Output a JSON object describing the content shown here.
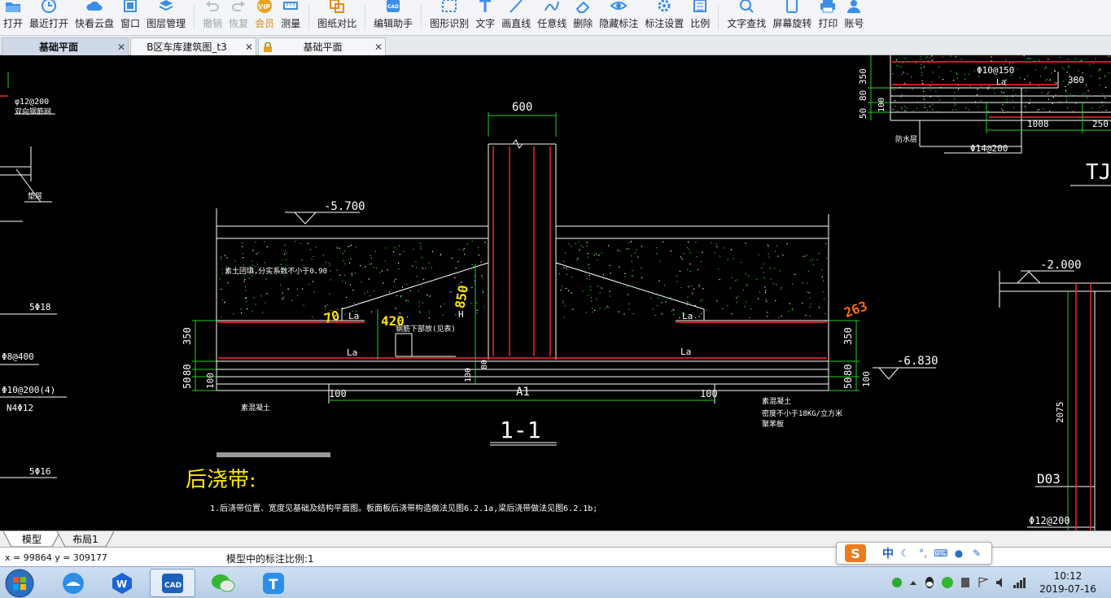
{
  "toolbar": {
    "items": [
      {
        "label": "打开",
        "icon": "folder-open-icon",
        "disabled": false
      },
      {
        "label": "最近打开",
        "icon": "clock-icon",
        "disabled": false
      },
      {
        "label": "快看云盘",
        "icon": "cloud-icon",
        "disabled": false
      },
      {
        "label": "窗口",
        "icon": "window-icon",
        "disabled": false
      },
      {
        "label": "图层管理",
        "icon": "layers-icon",
        "disabled": false
      },
      {
        "label": "撤销",
        "icon": "undo-icon",
        "disabled": true
      },
      {
        "label": "恢复",
        "icon": "redo-icon",
        "disabled": true
      },
      {
        "label": "会员",
        "icon": "vip-icon",
        "disabled": false,
        "badge": "VIP"
      },
      {
        "label": "测量",
        "icon": "ruler-icon",
        "disabled": false
      },
      {
        "label": "图纸对比",
        "icon": "compare-icon",
        "disabled": false
      },
      {
        "label": "编辑助手",
        "icon": "edit-assistant-icon",
        "disabled": false,
        "badge": "CAD"
      },
      {
        "label": "图形识别",
        "icon": "shape-recognize-icon",
        "disabled": false
      },
      {
        "label": "文字",
        "icon": "text-icon",
        "disabled": false
      },
      {
        "label": "画直线",
        "icon": "line-icon",
        "disabled": false
      },
      {
        "label": "任意线",
        "icon": "freehand-line-icon",
        "disabled": false
      },
      {
        "label": "删除",
        "icon": "eraser-icon",
        "disabled": false
      },
      {
        "label": "隐藏标注",
        "icon": "eye-icon",
        "disabled": false
      },
      {
        "label": "标注设置",
        "icon": "gear-icon",
        "disabled": false
      },
      {
        "label": "比例",
        "icon": "scale-icon",
        "disabled": false
      },
      {
        "label": "文字查找",
        "icon": "text-search-icon",
        "disabled": false
      },
      {
        "label": "屏幕旋转",
        "icon": "rotate-screen-icon",
        "disabled": false
      },
      {
        "label": "打印",
        "icon": "printer-icon",
        "disabled": false
      },
      {
        "label": "账号",
        "icon": "user-icon",
        "disabled": false
      }
    ]
  },
  "tabs": [
    {
      "label": "基础平面",
      "active": true,
      "locked": false
    },
    {
      "label": "B区车库建筑图_t3",
      "active": false,
      "locked": false
    },
    {
      "label": "基础平面",
      "active": false,
      "locked": true
    }
  ],
  "drawing": {
    "dim_600": "600",
    "elev_left": "-5.700",
    "elev_right": "-6.830",
    "elev_upper_right": "-2.000",
    "dim_350_left": "350",
    "dim_80_left": "80",
    "dim_50_left": "50",
    "dim_100_left": "100",
    "dim_350_right": "350",
    "dim_80_right": "80",
    "dim_50_right": "50",
    "dim_100_right": "100",
    "dim_100_a": "100",
    "dim_100_b": "100",
    "dim_100_c": "100",
    "dim_80_c": "80",
    "center_label": "A1",
    "la_1": "La",
    "la_2": "La",
    "la_3": "La",
    "la_4": "La",
    "la_5": "La",
    "la_6": "La",
    "h_mark": "H",
    "backfill_note": "素土回填,分实系数不小于0.90",
    "rebar_note_mid": "钢筋下部放(见表)",
    "section_title": "1-1",
    "houjiao_title": "后浇带:",
    "houjiao_note": "1.后浇带位置、宽度见基础及结构平面图。板面板后浇带构造做法见图6.2.1a,梁后浇带做法见图6.2.1b;",
    "left_rebar_1": "φ12@200",
    "left_rebar_1_sub": "双向钢筋网",
    "left_label_2": "垫层",
    "left_rebar_3": "5Φ18",
    "left_rebar_4": "Φ8@400",
    "left_rebar_5": "Φ10@200(4)",
    "left_rebar_6": "N4Φ12",
    "left_rebar_7": "5Φ16",
    "bottom_note_left": "素混凝土",
    "bottom_note_right_1": "素混凝土",
    "bottom_note_right_2": "密度不小于18KG/立方米",
    "bottom_note_right_3": "聚苯板",
    "ur_rebar_1": "Φ10@150",
    "ur_dim_380": "380",
    "ur_dim_350": "350",
    "ur_dim_80": "80",
    "ur_dim_100": "100",
    "ur_dim_50": "50",
    "ur_dim_1008": "1008",
    "ur_dim_250": "250",
    "ur_la": "La",
    "ur_label": "防水层",
    "ur_rebar_2": "Φ14@200",
    "ur_title": "TJ",
    "right_dim_2075": "2075",
    "right_label_d03": "D03",
    "right_rebar": "Φ12@200",
    "hand_70": "70",
    "hand_420": "420",
    "hand_850": "850",
    "hand_right": "263"
  },
  "layout_tabs": [
    {
      "label": "模型",
      "active": true
    },
    {
      "label": "布局1",
      "active": false
    }
  ],
  "status": {
    "coord": "x = 99864  y = 309177",
    "scale": "模型中的标注比例:1"
  },
  "ime": {
    "logo": "S",
    "mode": "中"
  },
  "taskbar": {
    "apps": [
      {
        "name": "browser-icon"
      },
      {
        "name": "wps-icon"
      },
      {
        "name": "cad-viewer-icon",
        "badge": "CAD"
      },
      {
        "name": "wechat-icon"
      },
      {
        "name": "text-tool-icon",
        "badge": "T"
      }
    ],
    "clock_time": "10:12",
    "clock_date": "2019-07-16"
  }
}
